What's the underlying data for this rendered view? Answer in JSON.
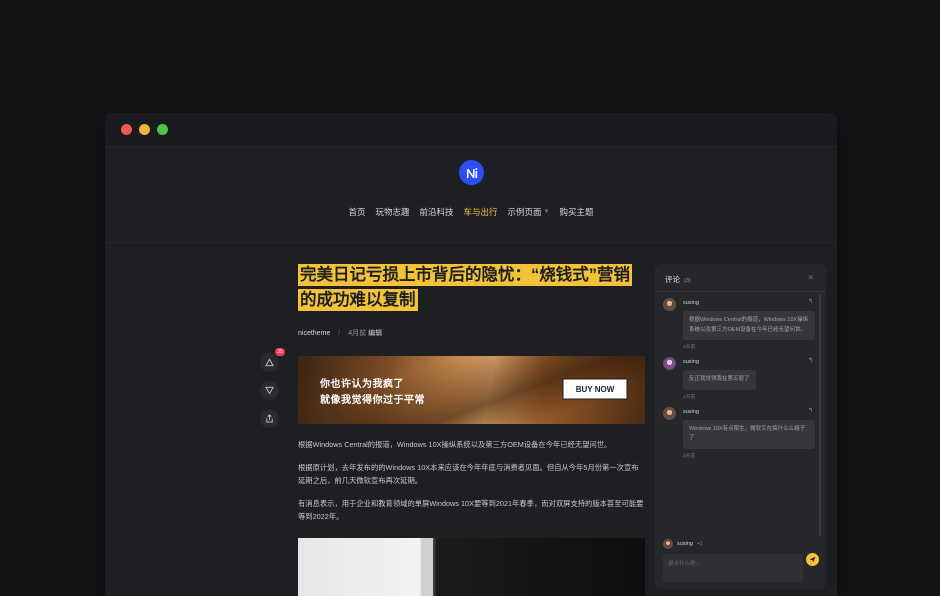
{
  "window": {
    "buttons": [
      "close",
      "minimize",
      "maximize"
    ]
  },
  "colors": {
    "accent": "#f3c238",
    "brand": "#2a4ff5",
    "badge": "#f2385a",
    "background": "#141416",
    "panel": "#1e1f22"
  },
  "header": {
    "logo_icon": "brand-logo",
    "nav": [
      {
        "label": "首页"
      },
      {
        "label": "玩物志趣"
      },
      {
        "label": "前沿科技"
      },
      {
        "label": "车与出行",
        "active": true
      },
      {
        "label": "示例页面",
        "has_dropdown": true
      },
      {
        "label": "购买主题"
      }
    ]
  },
  "side_actions": {
    "like_count": "35",
    "icons": [
      "thumbs-up-icon",
      "thumbs-down-icon",
      "share-icon"
    ]
  },
  "article": {
    "title": "完美日记亏损上市背后的隐忧：“烧钱式”营销的成功难以复制",
    "author": "nicetheme",
    "separator": "/",
    "date": "4月前",
    "edit_label": "编辑",
    "banner": {
      "line1": "你也许认为我疯了",
      "line2": "就像我觉得你过于平常",
      "cta": "BUY NOW"
    },
    "paragraphs": [
      "根据Windows Central的报道，Windows 10X操纵系统以及第三方OEM设备在今年已经无望问世。",
      "根据原计划，去年发布的的Windows 10X本来应该在今年年底与消费者见面。但自从今年5月份第一次宣布延期之后，前几天微软宣布再次延期。",
      "有消息表示，用于企业和教育领域的单屏Windows 10X要等到2021年春季，而对双屏支持的版本甚至可能要等到2022年。"
    ]
  },
  "comments": {
    "title": "评论",
    "count": "(3)",
    "close_icon": "close-icon",
    "items": [
      {
        "user": "suxing",
        "text": "根据Windows Central的报道，Windows 10X操纵系统以及第三方OEM设备在今年已经无望问世。",
        "time": "2天前"
      },
      {
        "user": "suxing",
        "text": "反正我觉得我在第五层了",
        "time": "2天前"
      },
      {
        "user": "suxing",
        "text": "Windows 10X有点陌生，微软又在搞什么么蛾子了",
        "time": "2天前"
      }
    ],
    "composer": {
      "user": "suxing",
      "plus": "+1",
      "placeholder": "说点什么吧..."
    }
  }
}
